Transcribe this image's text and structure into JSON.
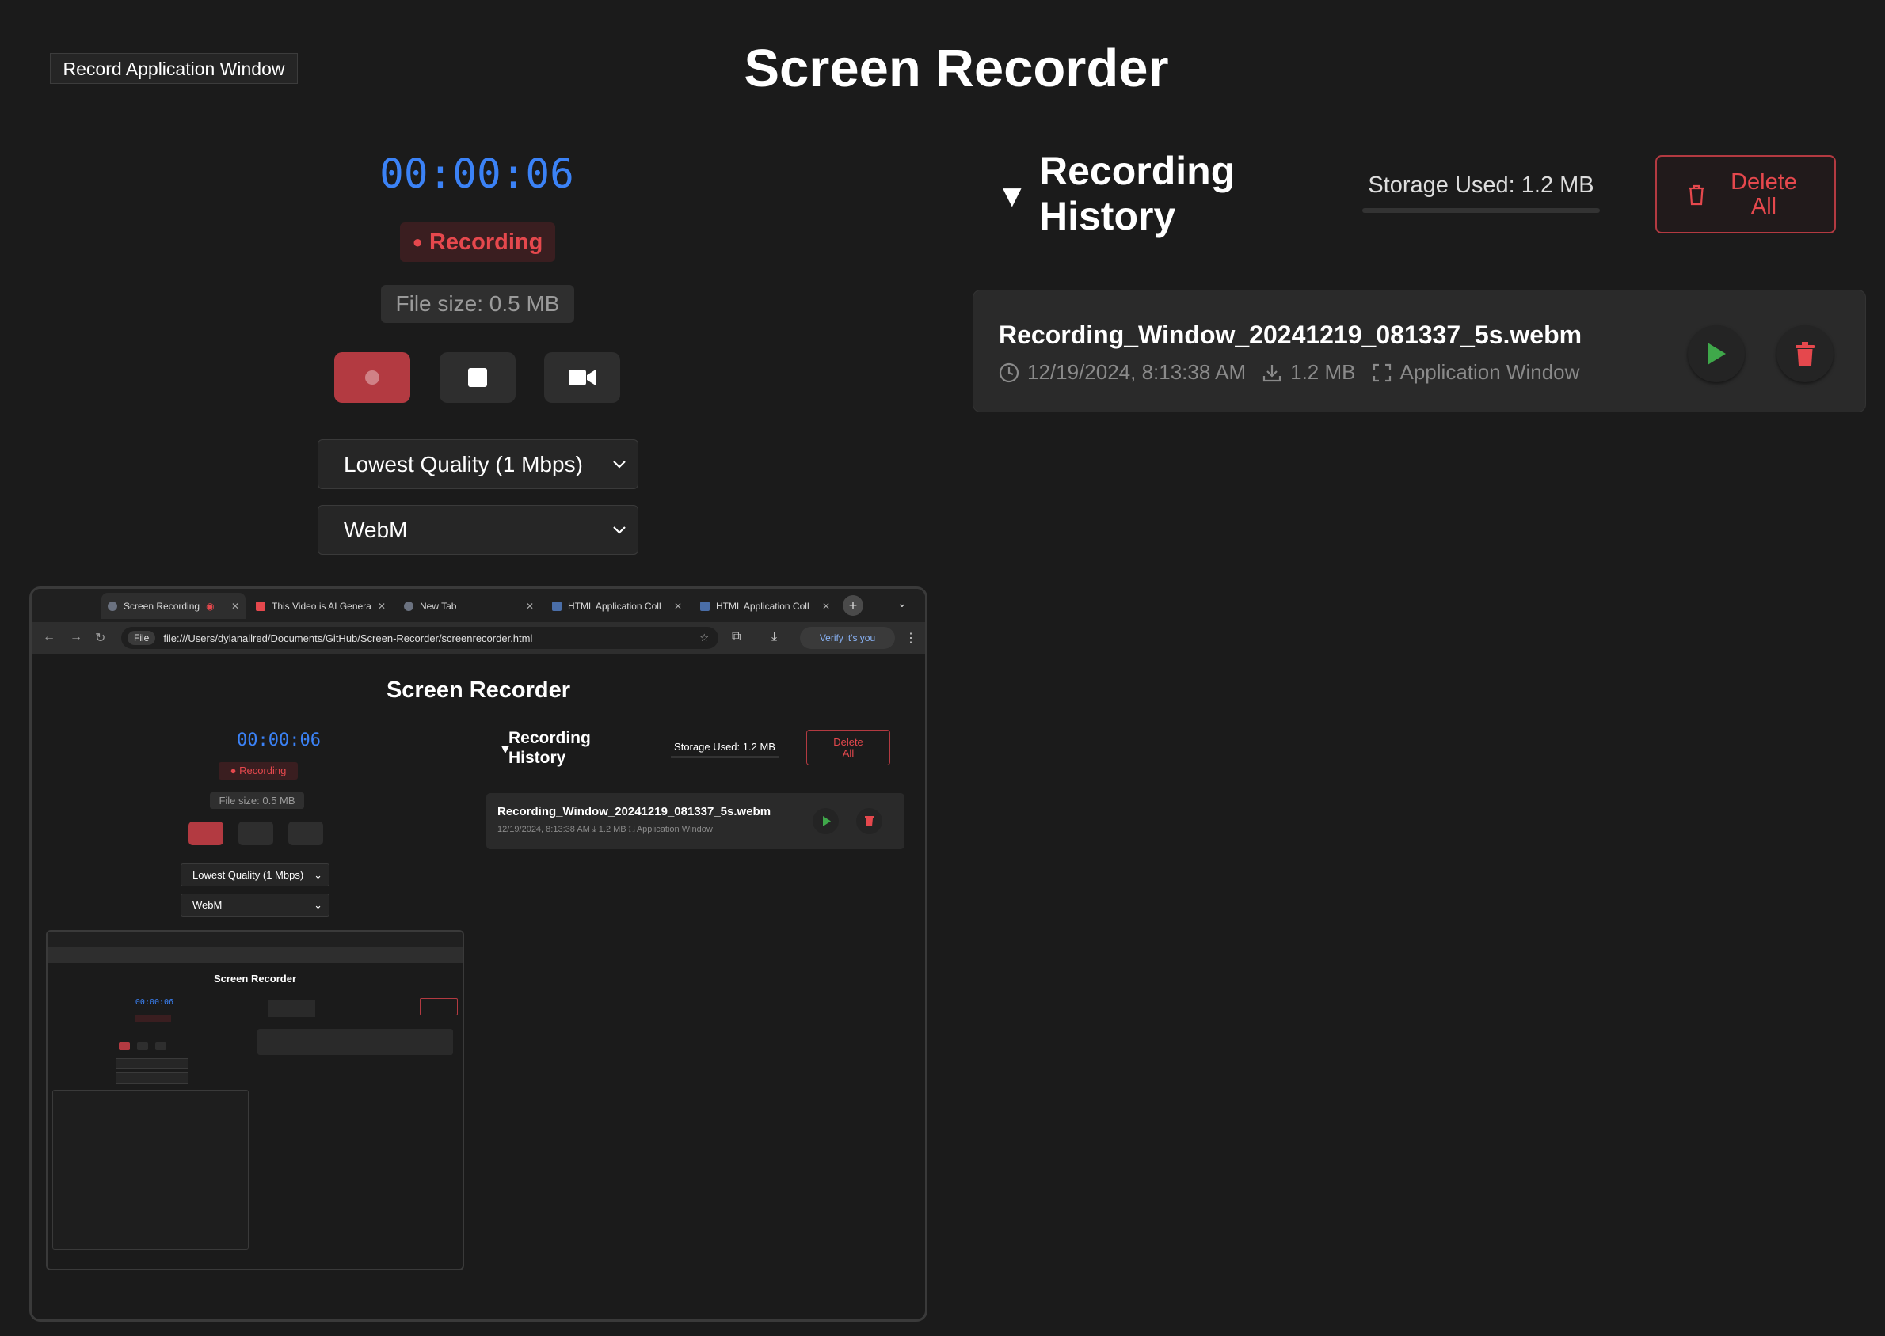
{
  "header": {
    "mode_button": "Record Application Window",
    "title": "Screen Recorder"
  },
  "recorder": {
    "timer": "00:00:06",
    "status": "Recording",
    "file_size": "File size: 0.5 MB",
    "buttons": {
      "record_icon": "record-dot-icon",
      "stop_icon": "stop-square-icon",
      "camera_icon": "video-camera-icon"
    },
    "quality_selected": "Lowest Quality (1 Mbps)",
    "format_selected": "WebM"
  },
  "history": {
    "title": "Recording History",
    "storage_used": "Storage Used: 1.2 MB",
    "delete_all": "Delete All",
    "recordings": [
      {
        "name": "Recording_Window_20241219_081337_5s.webm",
        "date": "12/19/2024, 8:13:38 AM",
        "size": "1.2 MB",
        "source": "Application Window"
      }
    ]
  },
  "preview": {
    "tabs": [
      {
        "label": "Screen Recording",
        "active": true
      },
      {
        "label": "This Video is AI Genera"
      },
      {
        "label": "New Tab"
      },
      {
        "label": "HTML Application Coll"
      },
      {
        "label": "HTML Application Coll"
      }
    ],
    "url_chip": "File",
    "url": "file:///Users/dylanallred/Documents/GitHub/Screen-Recorder/screenrecorder.html",
    "verify": "Verify it's you",
    "app": {
      "title": "Screen Recorder",
      "timer": "00:00:06",
      "status": "● Recording",
      "file_size": "File size: 0.5 MB",
      "quality": "Lowest Quality (1 Mbps)",
      "format": "WebM",
      "history_title": "Recording History",
      "storage_used": "Storage Used: 1.2 MB",
      "delete_all": "Delete All",
      "recording_name": "Recording_Window_20241219_081337_5s.webm",
      "recording_meta": "12/19/2024, 8:13:38 AM  ⤓ 1.2 MB  ⛶ Application Window"
    },
    "nested": {
      "title": "Screen Recorder",
      "timer": "00:00:06"
    }
  },
  "colors": {
    "background": "#1b1b1b",
    "accent_blue": "#3b82f6",
    "danger": "#e5484d",
    "play_green": "#3fa84a"
  }
}
